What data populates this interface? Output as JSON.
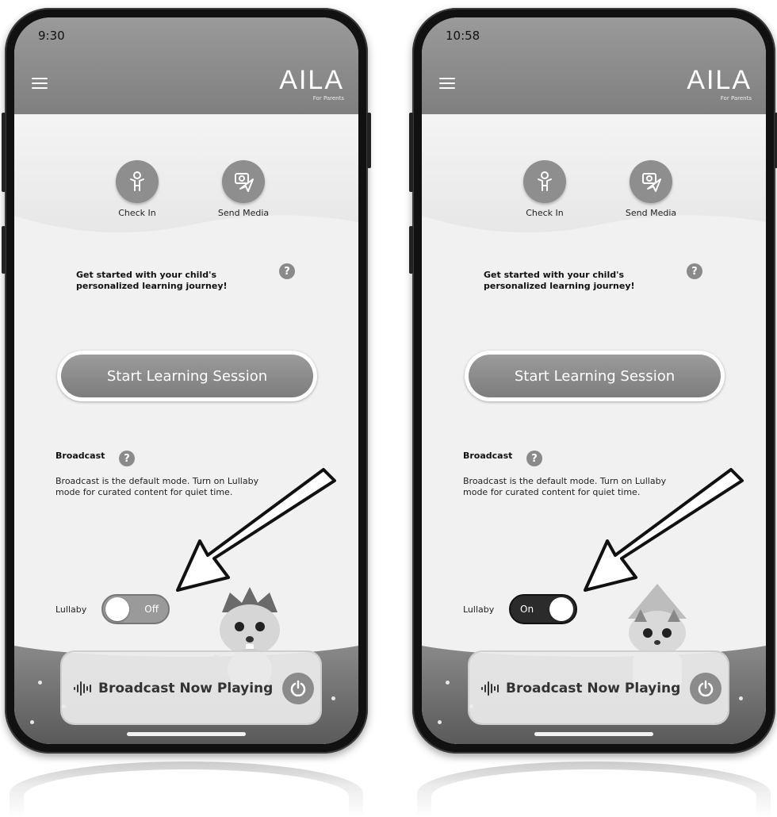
{
  "screens": [
    {
      "time": "9:30",
      "logo": {
        "text": "AILA",
        "subtitle": "For Parents"
      },
      "actions": [
        {
          "label": "Check In"
        },
        {
          "label": "Send Media"
        }
      ],
      "intro": "Get started with your child's personalized learning journey!",
      "start_button": "Start Learning Session",
      "broadcast": {
        "title": "Broadcast",
        "description": "Broadcast is the default mode. Turn on Lullaby mode for curated content for quiet time."
      },
      "lullaby": {
        "label": "Lullaby",
        "state": "Off"
      },
      "now_playing": "Broadcast Now Playing"
    },
    {
      "time": "10:58",
      "logo": {
        "text": "AILA",
        "subtitle": "For Parents"
      },
      "actions": [
        {
          "label": "Check In"
        },
        {
          "label": "Send Media"
        }
      ],
      "intro": "Get started with your child's personalized learning journey!",
      "start_button": "Start Learning Session",
      "broadcast": {
        "title": "Broadcast",
        "description": "Broadcast is the default mode. Turn on Lullaby mode for curated content for quiet time."
      },
      "lullaby": {
        "label": "Lullaby",
        "state": "On"
      },
      "now_playing": "Broadcast Now Playing"
    }
  ],
  "help_glyph": "?",
  "icons": [
    "menu-icon",
    "child-icon",
    "camera-send-icon",
    "help-icon",
    "sound-wave-icon",
    "power-icon",
    "arrow-annotation"
  ],
  "colors": {
    "header": "#8a8a8a",
    "toggle_on": "#2b2b2b",
    "toggle_off": "#9a9a9a"
  }
}
